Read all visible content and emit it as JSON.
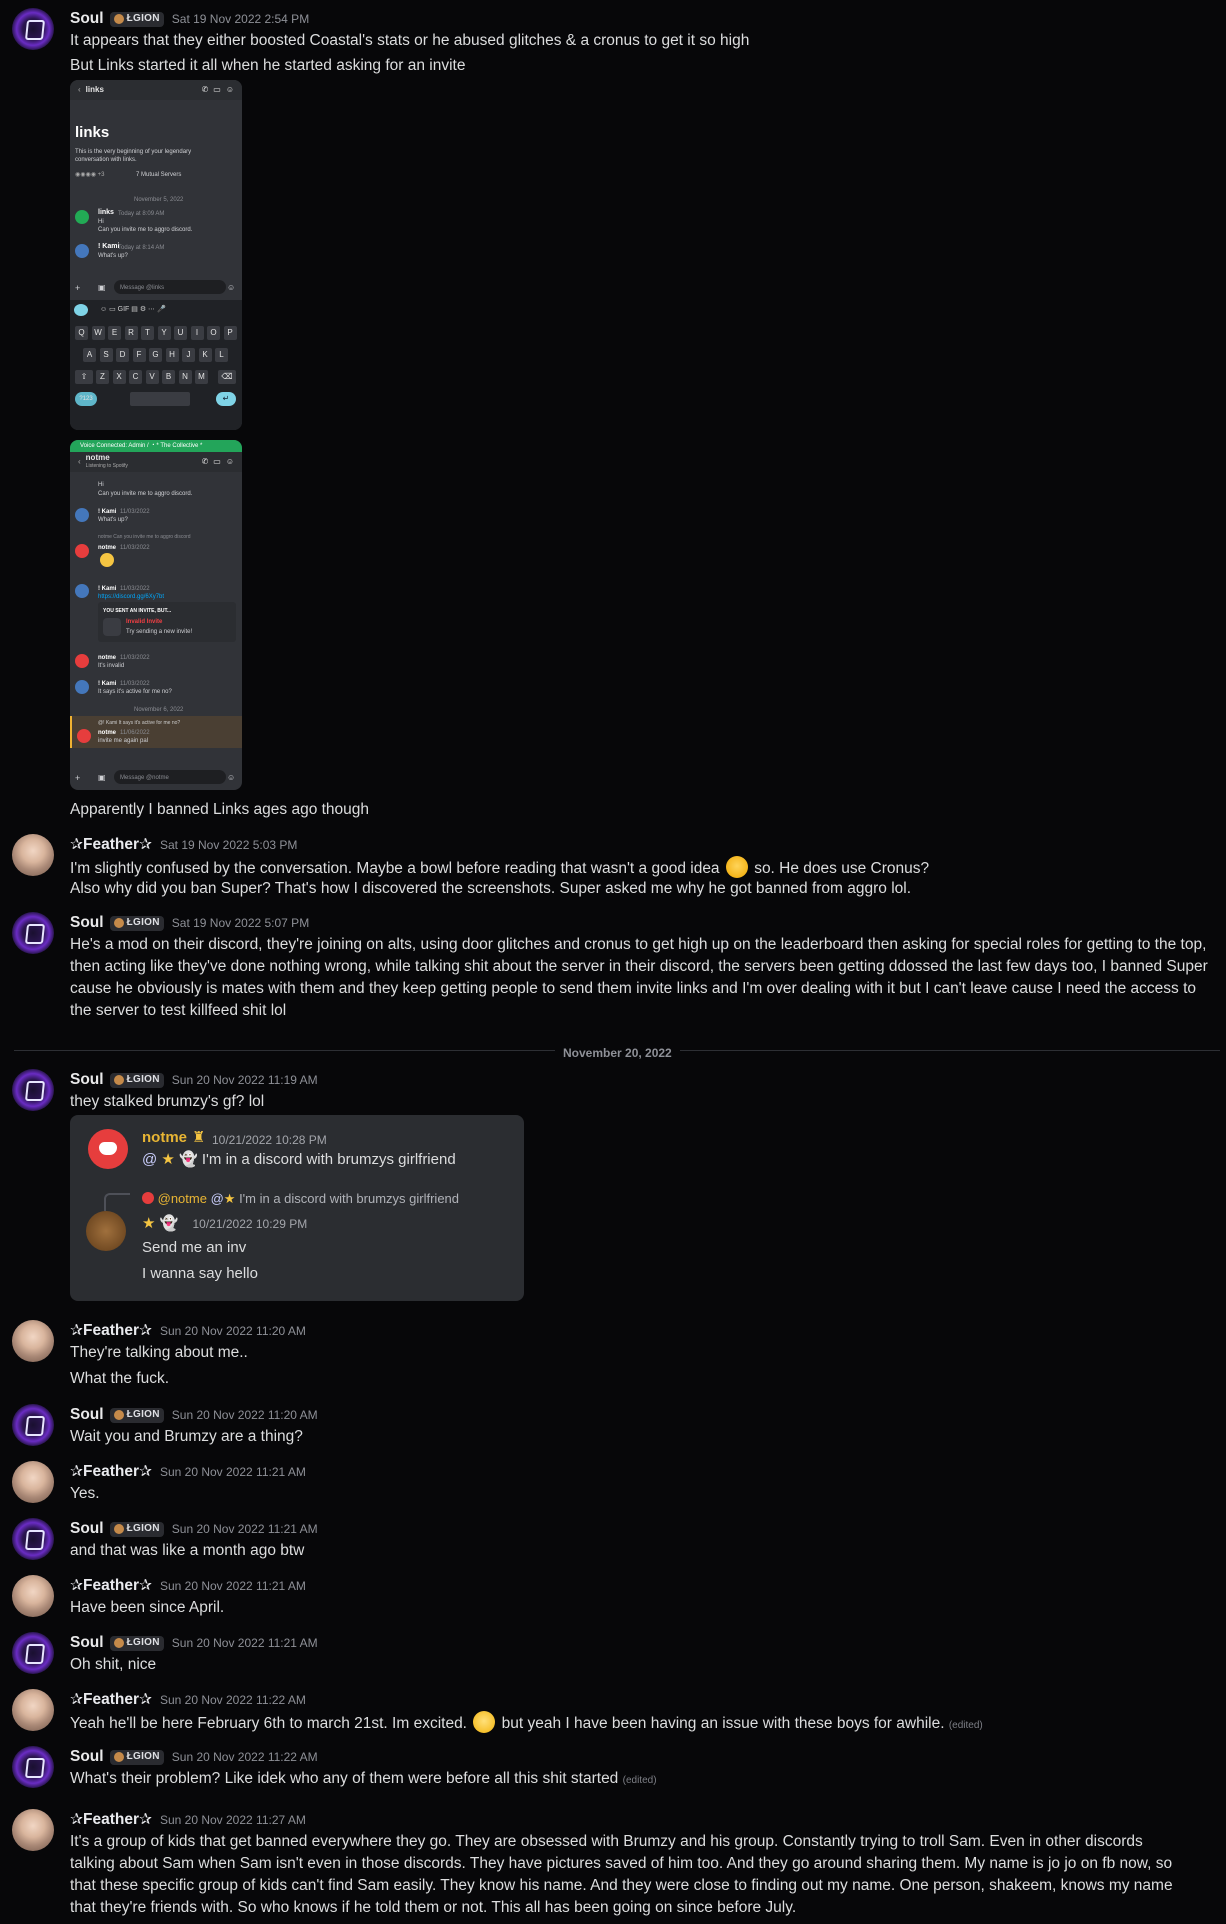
{
  "users": {
    "soul": {
      "name": "Soul",
      "tag": "ŁGION"
    },
    "feather": {
      "name": "✰Feather✰"
    }
  },
  "messages": [
    {
      "ts": "Sat 19 Nov 2022 2:54 PM",
      "lines": [
        "It appears that they either boosted Coastal's stats or he abused glitches & a cronus to get it so high",
        "But Links started it all when he started asking for an invite"
      ],
      "after": "Apparently I banned Links ages ago though"
    },
    {
      "ts": "Sat 19 Nov 2022 5:03 PM",
      "l1a": "I'm slightly confused by the conversation. Maybe a bowl before reading that wasn't a good idea",
      "l1b": "so. He does use Cronus?",
      "l2": "Also why did you ban Super? That's how I discovered the screenshots. Super asked me why he got banned from aggro lol."
    },
    {
      "ts": "Sat 19 Nov 2022 5:07 PM",
      "text": "He's a mod on their discord, they're joining on alts, using door glitches and cronus to get high up on the leaderboard then asking for special roles for getting to the top, then acting like they've done nothing wrong, while talking shit about the server in their discord, the servers been getting ddossed the last few days too, I banned Super cause he obviously is mates with them and they keep getting people to send them invite links and I'm over dealing with it but I can't leave cause I need the access to the server to test killfeed shit lol"
    },
    {
      "ts": "Sun 20 Nov 2022 11:19 AM",
      "text": "they stalked brumzy's gf? lol"
    },
    {
      "ts": "Sun 20 Nov 2022 11:20 AM",
      "lines": [
        "They're talking about me..",
        "What the fuck."
      ]
    },
    {
      "ts": "Sun 20 Nov 2022 11:20 AM",
      "text": "Wait you and Brumzy are a thing?"
    },
    {
      "ts": "Sun 20 Nov 2022 11:21 AM",
      "text": "Yes."
    },
    {
      "ts": "Sun 20 Nov 2022 11:21 AM",
      "text": "and that was like a month ago btw"
    },
    {
      "ts": "Sun 20 Nov 2022 11:21 AM",
      "text": "Have been since April."
    },
    {
      "ts": "Sun 20 Nov 2022 11:21 AM",
      "text": "Oh shit, nice"
    },
    {
      "ts": "Sun 20 Nov 2022 11:22 AM",
      "texta": "Yeah he'll be here February 6th to march 21st. Im excited.",
      "textb": "but yeah I have been having an issue with these boys for awhile.",
      "edited": "(edited)"
    },
    {
      "ts": "Sun 20 Nov 2022 11:22 AM",
      "text": "What's their problem? Like idek who any of them were before all this shit started",
      "edited": "(edited)"
    },
    {
      "ts": "Sun 20 Nov 2022 11:27 AM",
      "text": "It's a group of kids that get banned everywhere they go. They are obsessed with Brumzy and his group. Constantly trying to troll Sam. Even in other discords talking about Sam when Sam isn't even in those discords. They have pictures saved of him too. And they go around sharing them. My name is jo jo on fb now, so that these specific group of kids can't find Sam easily. They know his name. And they were close to finding out my name. One person, shakeem, knows my name that they're friends with. So who knows if he told them or not. This all has been going on since before July."
    }
  ],
  "divider": "November 20, 2022",
  "shot1": {
    "channel": "links",
    "title": "links",
    "desc1": "This is the very beginning of your legendary",
    "desc2": "conversation with links.",
    "mutual": "7 Mutual Servers",
    "date": "November 5, 2022",
    "m1_name": "links",
    "m1_ts": "Today at 8:09 AM",
    "m1_l1": "Hi",
    "m1_l2": "Can you invite me to aggro discord.",
    "m2_name": "! Kami",
    "m2_ts": "Today at 8:14 AM",
    "m2_l1": "What's up?",
    "input": "Message @links",
    "rows": [
      [
        "Q",
        "W",
        "E",
        "R",
        "T",
        "Y",
        "U",
        "I",
        "O",
        "P"
      ],
      [
        "A",
        "S",
        "D",
        "F",
        "G",
        "H",
        "J",
        "K",
        "L"
      ],
      [
        "Z",
        "X",
        "C",
        "V",
        "B",
        "N",
        "M"
      ]
    ],
    "num": "?123"
  },
  "shot2": {
    "banner": "Voice Connected: Admin / ・* The Collective *",
    "channel": "notme",
    "status": "Listening to Spotify",
    "l_hi": "Hi",
    "l_inv": "Can you invite me to aggro discord.",
    "kami": "! Kami",
    "d1": "11/03/2022",
    "whatsup": "What's up?",
    "reply1": "notme Can you invite me to aggro discord",
    "notme": "notme",
    "d2": "11/03/2022",
    "d3": "11/03/2022",
    "link": "https://discord.gg/6Xy7bt",
    "sent": "YOU SENT AN INVITE, BUT...",
    "invalid": "Invalid Invite",
    "try": "Try sending a new invite!",
    "d4": "11/03/2022",
    "its_invalid": "It's invalid",
    "d5": "11/03/2022",
    "active": "It says it's active for me no?",
    "date2": "November 6, 2022",
    "reply2": "@! Kami It says it's active for me no?",
    "d6": "11/06/2022",
    "again": "invite me again pal",
    "input": "Message @notme"
  },
  "embed": {
    "name": "notme",
    "ts1": "10/21/2022 10:28 PM",
    "line1": "I'm in a discord with brumzys girlfriend",
    "reply_name": "@notme",
    "reply_text": "I'm in a discord with brumzys girlfriend",
    "ts2": "10/21/2022 10:29 PM",
    "line2": "Send me an inv",
    "line3": "I wanna say hello"
  }
}
